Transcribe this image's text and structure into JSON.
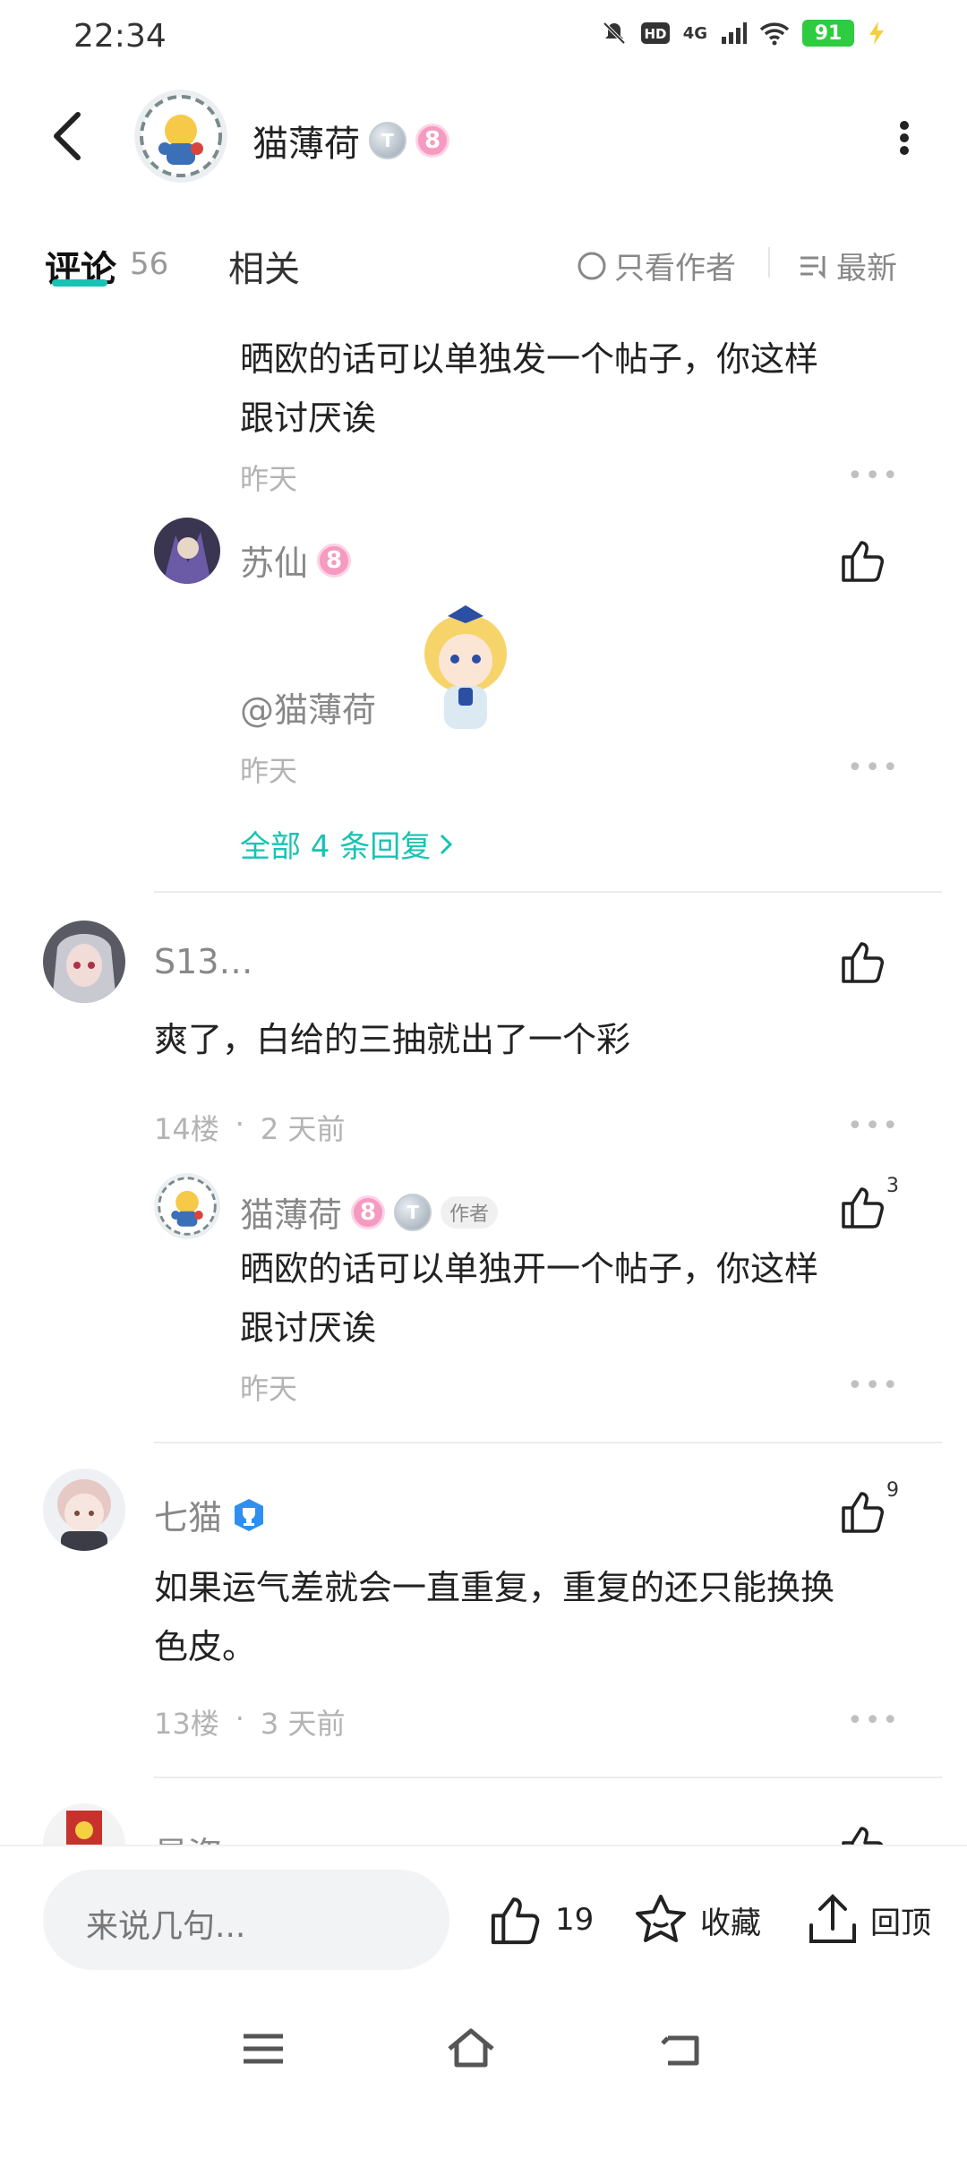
{
  "status_bar": {
    "time": "22:34",
    "network": "4G",
    "battery": "91",
    "icons": [
      "mute-icon",
      "hd-icon",
      "signal-icon",
      "wifi-icon",
      "battery-icon",
      "charging-icon"
    ]
  },
  "header": {
    "username": "猫薄荷",
    "badge_level": "8"
  },
  "tabs": {
    "comments_label": "评论",
    "comments_count": "56",
    "related_label": "相关",
    "filter_author_label": "只看作者",
    "sort_label": "最新"
  },
  "comments": {
    "reply_top": {
      "text_line1": "晒欧的话可以单独发一个帖子，你这样",
      "text_line2": "跟讨厌诶",
      "time": "昨天"
    },
    "reply_suxian": {
      "username": "苏仙",
      "badge_level": "8",
      "mention": "@猫薄荷",
      "time": "昨天",
      "all_replies": "全部 4 条回复"
    },
    "floor14": {
      "username": "S13…",
      "text": "爽了，白给的三抽就出了一个彩",
      "floor": "14楼",
      "time": "2 天前",
      "reply": {
        "username": "猫薄荷",
        "badge_level": "8",
        "author_tag": "作者",
        "likes": "3",
        "text_line1": "晒欧的话可以单独开一个帖子，你这样",
        "text_line2": "跟讨厌诶",
        "time": "昨天"
      }
    },
    "floor13": {
      "username": "七猫",
      "likes": "9",
      "text_line1": "如果运气差就会一直重复，重复的还只能换换",
      "text_line2": "色皮。",
      "floor": "13楼",
      "time": "3 天前"
    },
    "next_partial": {
      "username": "星盗"
    }
  },
  "bottom_bar": {
    "placeholder": "来说几句...",
    "like_count": "19",
    "favorite_label": "收藏",
    "top_label": "回顶"
  },
  "colors": {
    "accent": "#17c3b2",
    "badge_pink": "#f59ac0",
    "verified_blue": "#2f8ff0",
    "battery_green": "#2ecc40"
  }
}
